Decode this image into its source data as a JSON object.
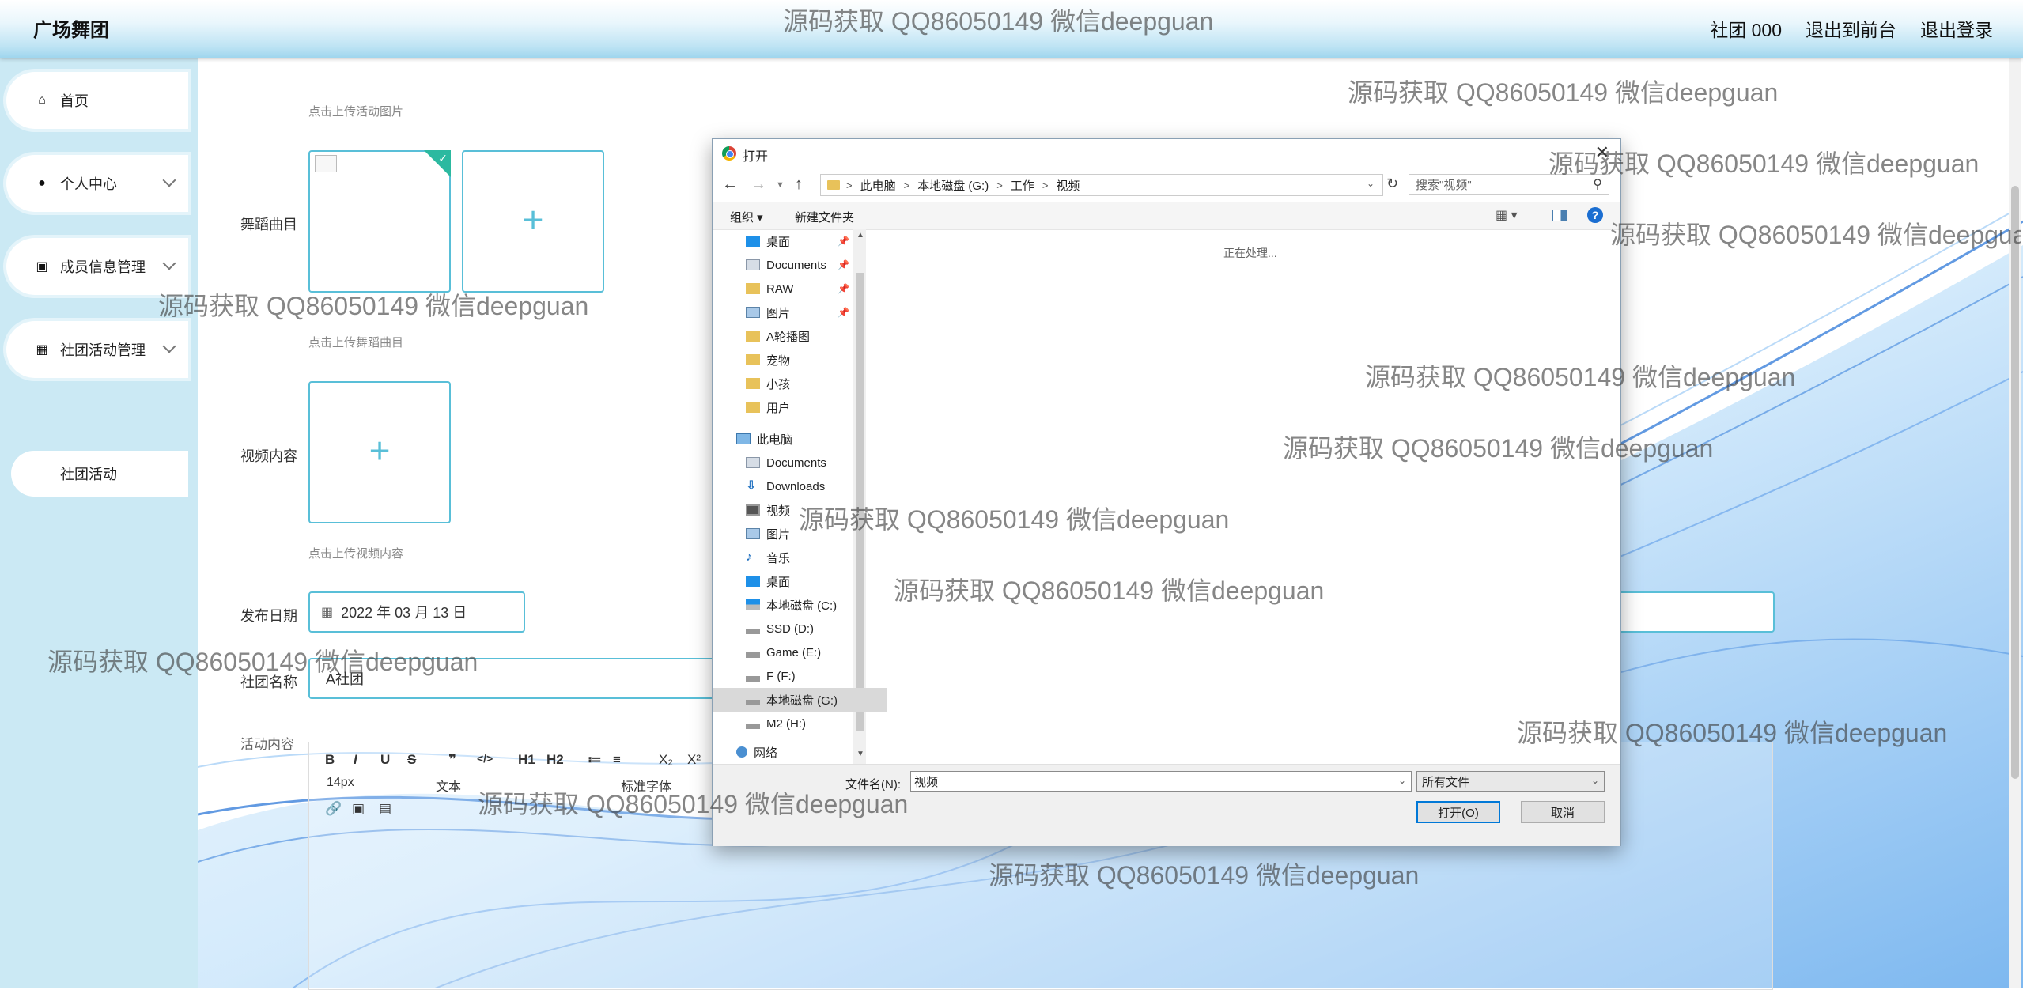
{
  "header": {
    "brand": "广场舞团",
    "links": [
      "社团 000",
      "退出到前台",
      "退出登录"
    ]
  },
  "sidebar": {
    "items": [
      {
        "label": "首页",
        "icon": "home-icon",
        "has_submenu": false
      },
      {
        "label": "个人中心",
        "icon": "user-icon",
        "has_submenu": true
      },
      {
        "label": "成员信息管理",
        "icon": "member-icon",
        "has_submenu": true
      },
      {
        "label": "社团活动管理",
        "icon": "grid-icon",
        "has_submenu": true
      }
    ],
    "subitem": "社团活动"
  },
  "form": {
    "hint_activity_image": "点击上传活动图片",
    "dance_label": "舞蹈曲目",
    "hint_dance": "点击上传舞蹈曲目",
    "video_label": "视频内容",
    "hint_video": "点击上传视频内容",
    "date_label": "发布日期",
    "date_value": "2022 年 03 月 13 日",
    "club_label": "社团名称",
    "club_value": "A社团",
    "content_label": "活动内容",
    "editor_toolbar": [
      "B",
      "I",
      "U",
      "S",
      "❞",
      "</>",
      "H1",
      "H2",
      "≔",
      "≡",
      "X₂",
      "X²"
    ],
    "editor_font_size": "14px",
    "editor_text_label": "文本",
    "editor_font_label": "标准字体"
  },
  "dialog": {
    "title": "打开",
    "breadcrumb": [
      "此电脑",
      "本地磁盘 (G:)",
      "工作",
      "视频"
    ],
    "search_placeholder": "搜索\"视频\"",
    "organize": "组织",
    "new_folder": "新建文件夹",
    "processing": "正在处理...",
    "quick_access": [
      {
        "label": "桌面",
        "pinned": true
      },
      {
        "label": "Documents",
        "pinned": true
      },
      {
        "label": "RAW",
        "pinned": true
      },
      {
        "label": "图片",
        "pinned": true
      },
      {
        "label": "A轮播图",
        "pinned": false
      },
      {
        "label": "宠物",
        "pinned": false
      },
      {
        "label": "小孩",
        "pinned": false
      },
      {
        "label": "用户",
        "pinned": false
      }
    ],
    "this_pc": "此电脑",
    "pc_items": [
      "Documents",
      "Downloads",
      "视频",
      "图片",
      "音乐",
      "桌面",
      "本地磁盘 (C:)",
      "SSD (D:)",
      "Game (E:)",
      "F (F:)",
      "本地磁盘 (G:)",
      "M2 (H:)"
    ],
    "selected_item": "本地磁盘 (G:)",
    "network": "网络",
    "filename_label": "文件名(N):",
    "filename_value": "视频",
    "filetype_value": "所有文件",
    "open_button": "打开(O)",
    "cancel_button": "取消"
  },
  "watermark": "源码获取 QQ86050149 微信deepguan",
  "colors": {
    "accent": "#59bfd8",
    "sidebar_bg": "#cbe9f4",
    "wave_blue": "#1f6fd6"
  }
}
